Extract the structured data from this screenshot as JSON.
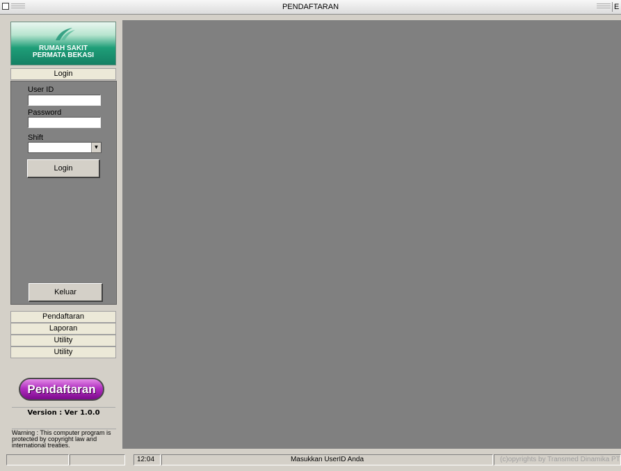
{
  "window": {
    "title": "PENDAFTARAN",
    "right_glyph": "E"
  },
  "logo": {
    "line1": "RUMAH SAKIT",
    "line2": "PERMATA BEKASI"
  },
  "login": {
    "header": "Login",
    "userid_label": "User ID",
    "userid_value": "",
    "password_label": "Password",
    "password_value": "",
    "shift_label": "Shift",
    "shift_value": "",
    "login_button": "Login",
    "exit_button": "Keluar"
  },
  "nav": {
    "items": [
      "Pendaftaran",
      "Laporan",
      "Utility",
      "Utility"
    ]
  },
  "app_badge": "Pendaftaran",
  "version": "Version : Ver 1.0.0",
  "warning": "Warning : This computer program is protected by copyright law and international treaties.",
  "statusbar": {
    "time": "12:04",
    "message": "Masukkan UserID Anda",
    "copyright": "(c)opyrights by Transmed Dinamika PT"
  },
  "icons": {
    "close": "close-box-icon",
    "dropdown": "chevron-down-icon",
    "logo": "hospital-logo-icon"
  }
}
